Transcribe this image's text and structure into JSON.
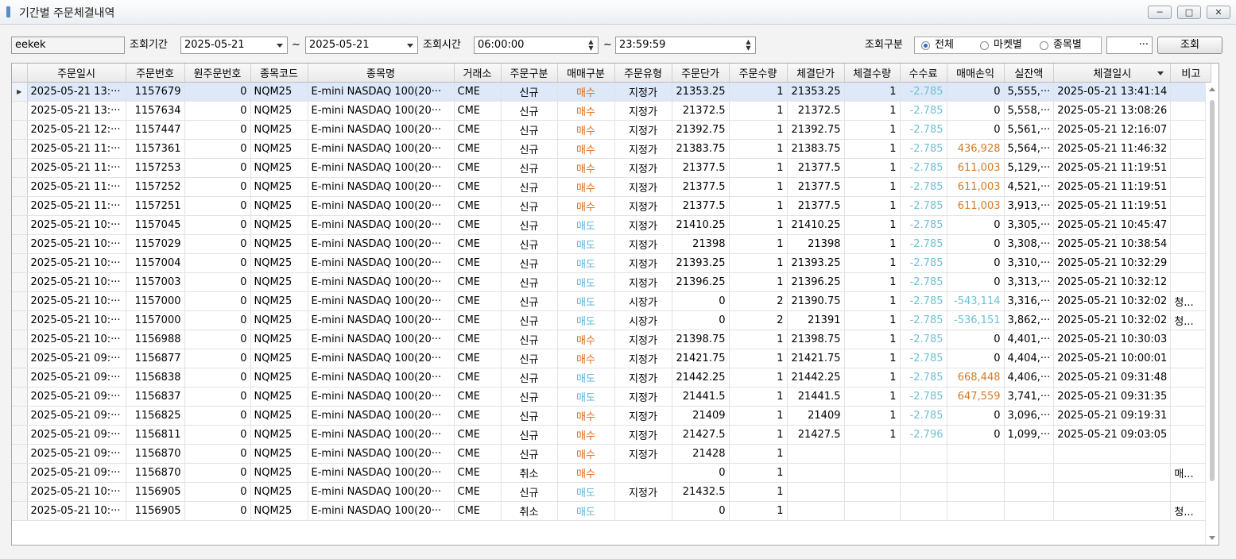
{
  "window": {
    "title": "기간별 주문체결내역",
    "minimize_icon": "minimize-icon",
    "maximize_icon": "maximize-icon",
    "close_icon": "close-icon"
  },
  "toolbar": {
    "account_value": "eekek",
    "period_label": "조회기간",
    "date_from": "2025-05-21",
    "tilde1": "~",
    "date_to": "2025-05-21",
    "time_label": "조회시간",
    "time_from": "06:00:00",
    "tilde2": "~",
    "time_to": "23:59:59",
    "query_type_label": "조회구분",
    "radio_all": "전체",
    "radio_market": "마켓별",
    "radio_symbol": "종목별",
    "selected_radio": "전체",
    "more_button": "···",
    "search_button": "조회"
  },
  "grid": {
    "headers": [
      "주문일시",
      "주문번호",
      "원주문번호",
      "종목코드",
      "종목명",
      "거래소",
      "주문구분",
      "매매구분",
      "주문유형",
      "주문단가",
      "주문수량",
      "체결단가",
      "체결수량",
      "수수료",
      "매매손익",
      "실잔액",
      "체결일시",
      "비고"
    ],
    "sort_icon": "sort-down-icon",
    "rows": [
      [
        "2025-05-21 13:···",
        "1157679",
        "0",
        "NQM25",
        "E-mini NASDAQ 100(20···",
        "CME",
        "신규",
        "매수",
        "지정가",
        "21353.25",
        "1",
        "21353.25",
        "1",
        "-2.785",
        "0",
        "5,555,···",
        "2025-05-21 13:41:14",
        ""
      ],
      [
        "2025-05-21 13:···",
        "1157634",
        "0",
        "NQM25",
        "E-mini NASDAQ 100(20···",
        "CME",
        "신규",
        "매수",
        "지정가",
        "21372.5",
        "1",
        "21372.5",
        "1",
        "-2.785",
        "0",
        "5,558,···",
        "2025-05-21 13:08:26",
        ""
      ],
      [
        "2025-05-21 12:···",
        "1157447",
        "0",
        "NQM25",
        "E-mini NASDAQ 100(20···",
        "CME",
        "신규",
        "매수",
        "지정가",
        "21392.75",
        "1",
        "21392.75",
        "1",
        "-2.785",
        "0",
        "5,561,···",
        "2025-05-21 12:16:07",
        ""
      ],
      [
        "2025-05-21 11:···",
        "1157361",
        "0",
        "NQM25",
        "E-mini NASDAQ 100(20···",
        "CME",
        "신규",
        "매수",
        "지정가",
        "21383.75",
        "1",
        "21383.75",
        "1",
        "-2.785",
        "436,928",
        "5,564,···",
        "2025-05-21 11:46:32",
        ""
      ],
      [
        "2025-05-21 11:···",
        "1157253",
        "0",
        "NQM25",
        "E-mini NASDAQ 100(20···",
        "CME",
        "신규",
        "매수",
        "지정가",
        "21377.5",
        "1",
        "21377.5",
        "1",
        "-2.785",
        "611,003",
        "5,129,···",
        "2025-05-21 11:19:51",
        ""
      ],
      [
        "2025-05-21 11:···",
        "1157252",
        "0",
        "NQM25",
        "E-mini NASDAQ 100(20···",
        "CME",
        "신규",
        "매수",
        "지정가",
        "21377.5",
        "1",
        "21377.5",
        "1",
        "-2.785",
        "611,003",
        "4,521,···",
        "2025-05-21 11:19:51",
        ""
      ],
      [
        "2025-05-21 11:···",
        "1157251",
        "0",
        "NQM25",
        "E-mini NASDAQ 100(20···",
        "CME",
        "신규",
        "매수",
        "지정가",
        "21377.5",
        "1",
        "21377.5",
        "1",
        "-2.785",
        "611,003",
        "3,913,···",
        "2025-05-21 11:19:51",
        ""
      ],
      [
        "2025-05-21 10:···",
        "1157045",
        "0",
        "NQM25",
        "E-mini NASDAQ 100(20···",
        "CME",
        "신규",
        "매도",
        "지정가",
        "21410.25",
        "1",
        "21410.25",
        "1",
        "-2.785",
        "0",
        "3,305,···",
        "2025-05-21 10:45:47",
        ""
      ],
      [
        "2025-05-21 10:···",
        "1157029",
        "0",
        "NQM25",
        "E-mini NASDAQ 100(20···",
        "CME",
        "신규",
        "매도",
        "지정가",
        "21398",
        "1",
        "21398",
        "1",
        "-2.785",
        "0",
        "3,308,···",
        "2025-05-21 10:38:54",
        ""
      ],
      [
        "2025-05-21 10:···",
        "1157004",
        "0",
        "NQM25",
        "E-mini NASDAQ 100(20···",
        "CME",
        "신규",
        "매도",
        "지정가",
        "21393.25",
        "1",
        "21393.25",
        "1",
        "-2.785",
        "0",
        "3,310,···",
        "2025-05-21 10:32:29",
        ""
      ],
      [
        "2025-05-21 10:···",
        "1157003",
        "0",
        "NQM25",
        "E-mini NASDAQ 100(20···",
        "CME",
        "신규",
        "매도",
        "지정가",
        "21396.25",
        "1",
        "21396.25",
        "1",
        "-2.785",
        "0",
        "3,313,···",
        "2025-05-21 10:32:12",
        ""
      ],
      [
        "2025-05-21 10:···",
        "1157000",
        "0",
        "NQM25",
        "E-mini NASDAQ 100(20···",
        "CME",
        "신규",
        "매도",
        "시장가",
        "0",
        "2",
        "21390.75",
        "1",
        "-2.785",
        "-543,114",
        "3,316,···",
        "2025-05-21 10:32:02",
        "청..."
      ],
      [
        "2025-05-21 10:···",
        "1157000",
        "0",
        "NQM25",
        "E-mini NASDAQ 100(20···",
        "CME",
        "신규",
        "매도",
        "시장가",
        "0",
        "2",
        "21391",
        "1",
        "-2.785",
        "-536,151",
        "3,862,···",
        "2025-05-21 10:32:02",
        "청..."
      ],
      [
        "2025-05-21 10:···",
        "1156988",
        "0",
        "NQM25",
        "E-mini NASDAQ 100(20···",
        "CME",
        "신규",
        "매수",
        "지정가",
        "21398.75",
        "1",
        "21398.75",
        "1",
        "-2.785",
        "0",
        "4,401,···",
        "2025-05-21 10:30:03",
        ""
      ],
      [
        "2025-05-21 09:···",
        "1156877",
        "0",
        "NQM25",
        "E-mini NASDAQ 100(20···",
        "CME",
        "신규",
        "매수",
        "지정가",
        "21421.75",
        "1",
        "21421.75",
        "1",
        "-2.785",
        "0",
        "4,404,···",
        "2025-05-21 10:00:01",
        ""
      ],
      [
        "2025-05-21 09:···",
        "1156838",
        "0",
        "NQM25",
        "E-mini NASDAQ 100(20···",
        "CME",
        "신규",
        "매도",
        "지정가",
        "21442.25",
        "1",
        "21442.25",
        "1",
        "-2.785",
        "668,448",
        "4,406,···",
        "2025-05-21 09:31:48",
        ""
      ],
      [
        "2025-05-21 09:···",
        "1156837",
        "0",
        "NQM25",
        "E-mini NASDAQ 100(20···",
        "CME",
        "신규",
        "매도",
        "지정가",
        "21441.5",
        "1",
        "21441.5",
        "1",
        "-2.785",
        "647,559",
        "3,741,···",
        "2025-05-21 09:31:35",
        ""
      ],
      [
        "2025-05-21 09:···",
        "1156825",
        "0",
        "NQM25",
        "E-mini NASDAQ 100(20···",
        "CME",
        "신규",
        "매수",
        "지정가",
        "21409",
        "1",
        "21409",
        "1",
        "-2.785",
        "0",
        "3,096,···",
        "2025-05-21 09:19:31",
        ""
      ],
      [
        "2025-05-21 09:···",
        "1156811",
        "0",
        "NQM25",
        "E-mini NASDAQ 100(20···",
        "CME",
        "신규",
        "매수",
        "지정가",
        "21427.5",
        "1",
        "21427.5",
        "1",
        "-2.796",
        "0",
        "1,099,···",
        "2025-05-21 09:03:05",
        ""
      ],
      [
        "2025-05-21 09:···",
        "1156870",
        "0",
        "NQM25",
        "E-mini NASDAQ 100(20···",
        "CME",
        "신규",
        "매수",
        "지정가",
        "21428",
        "1",
        "",
        "",
        "",
        "",
        "",
        "",
        ""
      ],
      [
        "2025-05-21 09:···",
        "1156870",
        "0",
        "NQM25",
        "E-mini NASDAQ 100(20···",
        "CME",
        "취소",
        "매수",
        "",
        "0",
        "1",
        "",
        "",
        "",
        "",
        "",
        "",
        "매..."
      ],
      [
        "2025-05-21 10:···",
        "1156905",
        "0",
        "NQM25",
        "E-mini NASDAQ 100(20···",
        "CME",
        "신규",
        "매도",
        "지정가",
        "21432.5",
        "1",
        "",
        "",
        "",
        "",
        "",
        "",
        ""
      ],
      [
        "2025-05-21 10:···",
        "1156905",
        "0",
        "NQM25",
        "E-mini NASDAQ 100(20···",
        "CME",
        "취소",
        "매도",
        "",
        "0",
        "1",
        "",
        "",
        "",
        "",
        "",
        "",
        "청..."
      ]
    ],
    "selected_row": 0
  },
  "colors": {
    "buy": "#e06a1a",
    "sell": "#5fb2d9",
    "profit": "#d37a24",
    "loss": "#6fc0d6",
    "fee": "#6fc0d6",
    "selected_row": "#dde8f8"
  }
}
